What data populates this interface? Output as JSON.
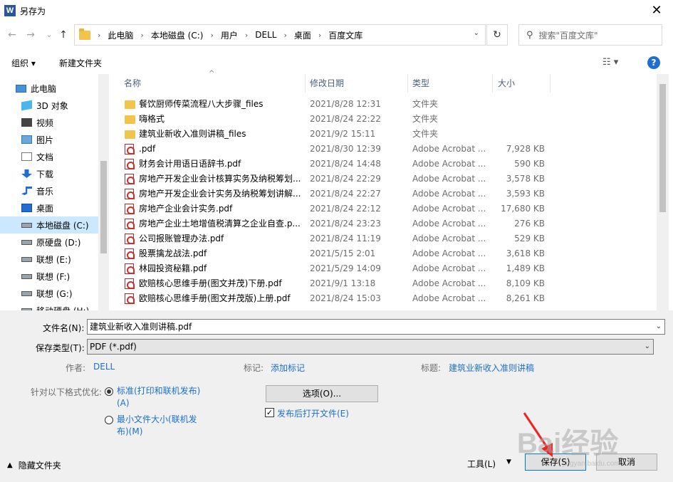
{
  "window": {
    "title": "另存为",
    "app_icon_letter": "W",
    "close_label": "✕"
  },
  "nav": {
    "back": "←",
    "forward": "→",
    "recent": "⌄",
    "up": "↑",
    "breadcrumbs": [
      "此电脑",
      "本地磁盘 (C:)",
      "用户",
      "DELL",
      "桌面",
      "百度文库"
    ],
    "search_placeholder": "搜索\"百度文库\""
  },
  "toolbar": {
    "organize": "组织 ▾",
    "new_folder": "新建文件夹",
    "help": "?"
  },
  "sidebar": {
    "items": [
      {
        "label": "此电脑",
        "icon": "computer-icon",
        "indent": 0,
        "selected": false
      },
      {
        "label": "3D 对象",
        "icon": "cube-icon",
        "indent": 1,
        "selected": false
      },
      {
        "label": "视频",
        "icon": "video-icon",
        "indent": 1,
        "selected": false
      },
      {
        "label": "图片",
        "icon": "picture-icon",
        "indent": 1,
        "selected": false
      },
      {
        "label": "文档",
        "icon": "document-icon",
        "indent": 1,
        "selected": false
      },
      {
        "label": "下载",
        "icon": "download-icon",
        "indent": 1,
        "selected": false
      },
      {
        "label": "音乐",
        "icon": "music-icon",
        "indent": 1,
        "selected": false
      },
      {
        "label": "桌面",
        "icon": "desktop-icon",
        "indent": 1,
        "selected": false
      },
      {
        "label": "本地磁盘 (C:)",
        "icon": "drive-icon",
        "indent": 1,
        "selected": true
      },
      {
        "label": "原硬盘 (D:)",
        "icon": "drive-icon",
        "indent": 1,
        "selected": false
      },
      {
        "label": "联想 (E:)",
        "icon": "drive-icon",
        "indent": 1,
        "selected": false
      },
      {
        "label": "联想 (F:)",
        "icon": "drive-icon",
        "indent": 1,
        "selected": false
      },
      {
        "label": "联想 (G:)",
        "icon": "drive-icon",
        "indent": 1,
        "selected": false
      },
      {
        "label": "移动硬盘 (H:)",
        "icon": "drive-icon",
        "indent": 1,
        "selected": false
      }
    ]
  },
  "columns": {
    "name": "名称",
    "date": "修改日期",
    "type": "类型",
    "size": "大小"
  },
  "files": [
    {
      "name": "餐饮厨师传菜流程八大步骤_files",
      "date": "2021/8/28 12:31",
      "type": "文件夹",
      "size": "",
      "kind": "folder"
    },
    {
      "name": "嗨格式",
      "date": "2021/8/24 22:22",
      "type": "文件夹",
      "size": "",
      "kind": "folder"
    },
    {
      "name": "建筑业新收入准则讲稿_files",
      "date": "2021/9/2 15:11",
      "type": "文件夹",
      "size": "",
      "kind": "folder"
    },
    {
      "name": ".pdf",
      "date": "2021/8/30 12:39",
      "type": "Adobe Acrobat ...",
      "size": "7,928 KB",
      "kind": "pdf"
    },
    {
      "name": "财务会计用语日语辞书.pdf",
      "date": "2021/8/24 14:48",
      "type": "Adobe Acrobat ...",
      "size": "590 KB",
      "kind": "pdf"
    },
    {
      "name": "房地产开发企业会计核算实务及纳税筹划...",
      "date": "2021/8/24 22:29",
      "type": "Adobe Acrobat ...",
      "size": "3,578 KB",
      "kind": "pdf"
    },
    {
      "name": "房地产开发企业会计实务及纳税筹划讲解...",
      "date": "2021/8/24 22:27",
      "type": "Adobe Acrobat ...",
      "size": "3,593 KB",
      "kind": "pdf"
    },
    {
      "name": "房地产企业会计实务.pdf",
      "date": "2021/8/24 22:12",
      "type": "Adobe Acrobat ...",
      "size": "17,680 KB",
      "kind": "pdf"
    },
    {
      "name": "房地产企业土地增值税清算之企业自查.p...",
      "date": "2021/8/24 23:23",
      "type": "Adobe Acrobat ...",
      "size": "276 KB",
      "kind": "pdf"
    },
    {
      "name": "公司报账管理办法.pdf",
      "date": "2021/8/24 11:19",
      "type": "Adobe Acrobat ...",
      "size": "529 KB",
      "kind": "pdf"
    },
    {
      "name": "股票擒龙战法.pdf",
      "date": "2021/5/15 2:01",
      "type": "Adobe Acrobat ...",
      "size": "3,618 KB",
      "kind": "pdf"
    },
    {
      "name": "林园投资秘籍.pdf",
      "date": "2021/5/29 14:09",
      "type": "Adobe Acrobat ...",
      "size": "1,489 KB",
      "kind": "pdf"
    },
    {
      "name": "欧赔核心思维手册(图文并茂)下册.pdf",
      "date": "2021/9/1 13:18",
      "type": "Adobe Acrobat ...",
      "size": "8,109 KB",
      "kind": "pdf"
    },
    {
      "name": "欧赔核心思维手册(图文并茂版)上册.pdf",
      "date": "2021/8/24 15:03",
      "type": "Adobe Acrobat ...",
      "size": "8,261 KB",
      "kind": "pdf"
    }
  ],
  "form": {
    "filename_label": "文件名(N):",
    "filename_value": "建筑业新收入准则讲稿.pdf",
    "filetype_label": "保存类型(T):",
    "filetype_value": "PDF (*.pdf)",
    "author_label": "作者:",
    "author_value": "DELL",
    "tags_label": "标记:",
    "tags_value": "添加标记",
    "title_label": "标题:",
    "title_value": "建筑业新收入准则讲稿",
    "optimize_label": "针对以下格式优化:",
    "opt_standard_line1": "标准(打印和联机发布)",
    "opt_standard_line2": "(A)",
    "opt_min_line1": "最小文件大小(联机发",
    "opt_min_line2": "布)(M)",
    "options_button": "选项(O)...",
    "open_after_label": "发布后打开文件(E)",
    "open_after_checked": "✓"
  },
  "footer": {
    "hide_folders": "隐藏文件夹",
    "tools": "工具(L)",
    "save": "保存(S)",
    "cancel": "取消"
  },
  "watermark": {
    "text": "Bai经验",
    "sub": "jingyan.baidu.com"
  }
}
